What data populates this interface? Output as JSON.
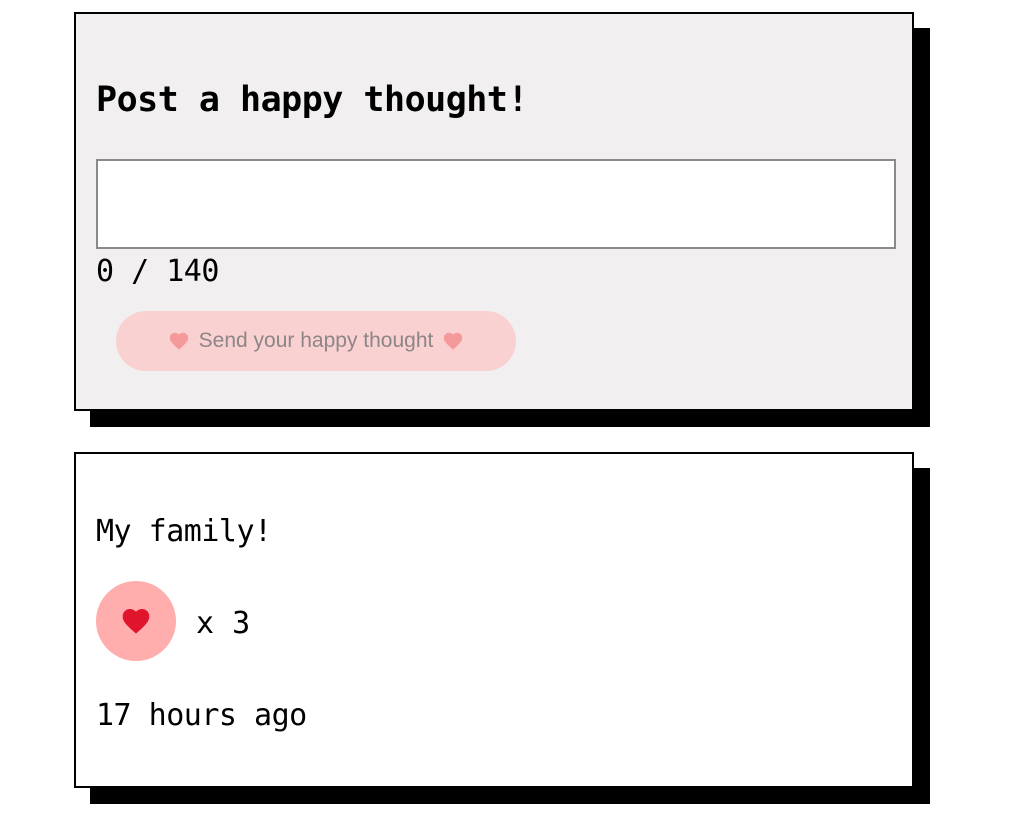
{
  "form": {
    "title": "Post a happy thought!",
    "input_value": "",
    "char_count": "0 / 140",
    "send_label": "Send your happy thought"
  },
  "thought": {
    "message": "My family!",
    "like_count": "x 3",
    "time_ago": "17 hours ago"
  },
  "icons": {
    "send_left": "heart-icon",
    "send_right": "heart-icon",
    "like": "heart-icon"
  },
  "colors": {
    "form_bg": "#f2eff0",
    "button_bg": "#f9d1d1",
    "like_bg": "#ffadad",
    "heart": "#e0142a"
  }
}
